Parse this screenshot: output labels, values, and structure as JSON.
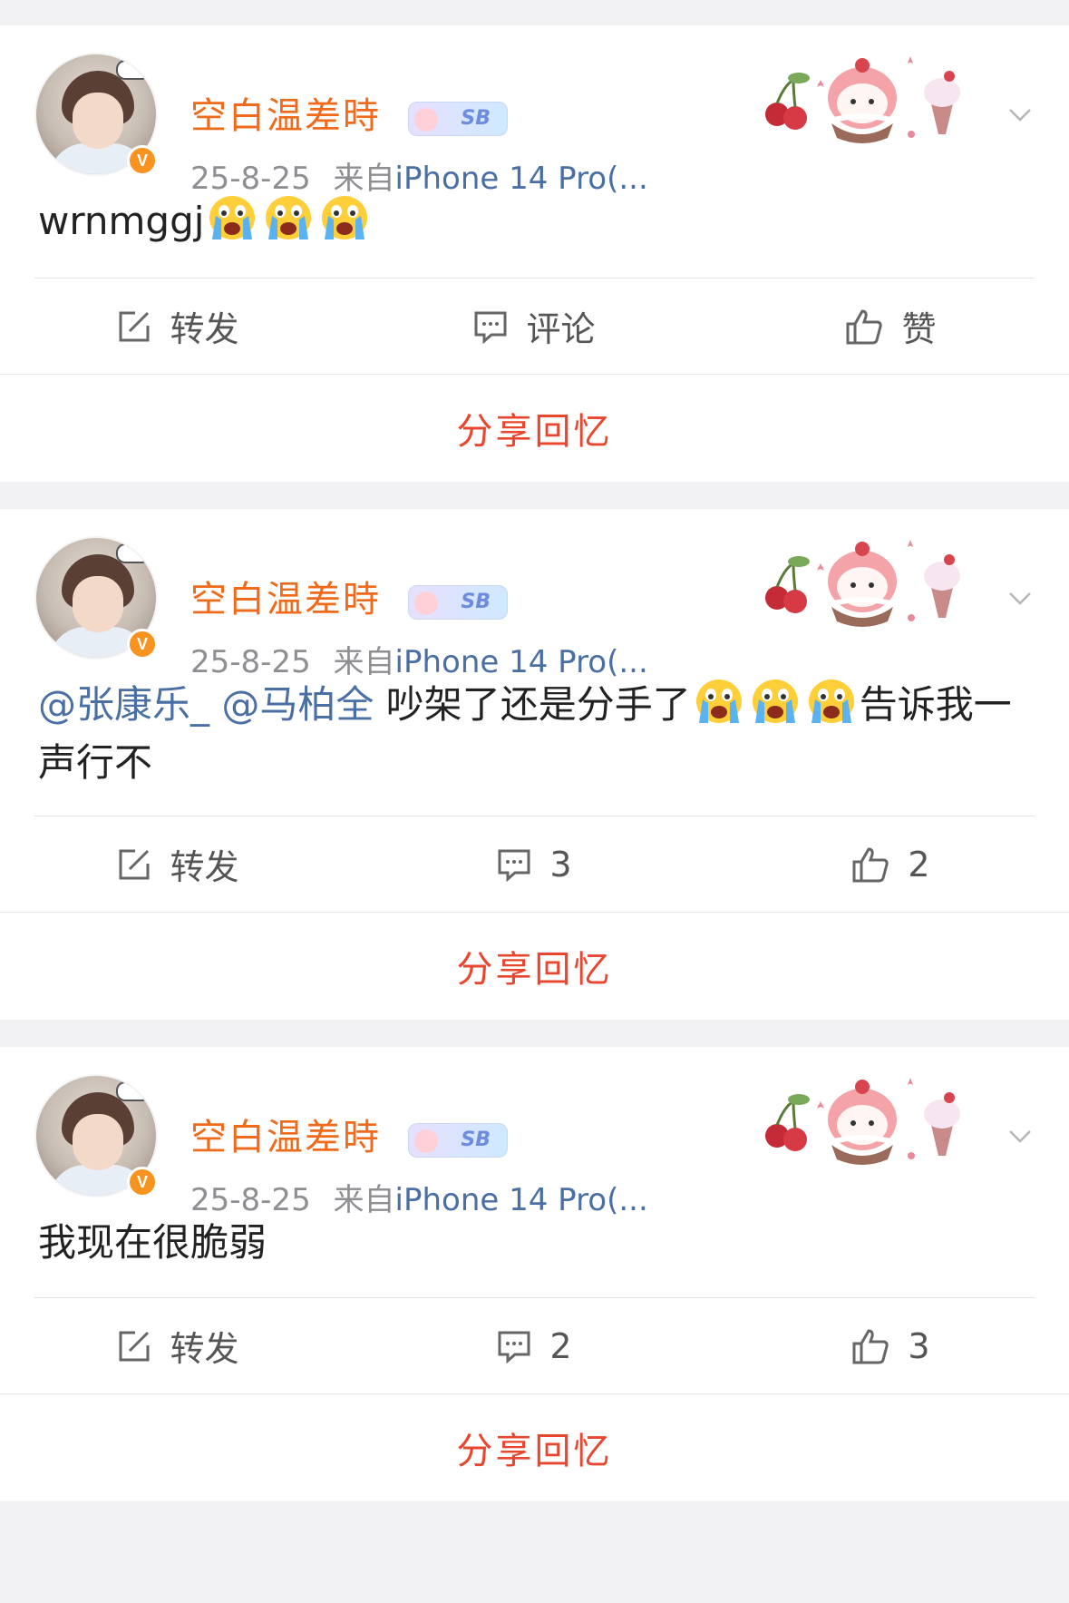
{
  "colors": {
    "username": "#f06a1b",
    "source": "#4a6fa5",
    "mention": "#4a6fa5",
    "share": "#e8462e",
    "verify": "#f7931e"
  },
  "posts": [
    {
      "username": "空白温差時",
      "badge": "SB",
      "date": "25-8-25",
      "from_label": "来自",
      "source": "iPhone 14 Pro(...",
      "text": "wrnmggj",
      "emoji_count": 3,
      "actions": {
        "repost": "转发",
        "comment": "评论",
        "like": "赞"
      },
      "share": "分享回忆"
    },
    {
      "username": "空白温差時",
      "badge": "SB",
      "date": "25-8-25",
      "from_label": "来自",
      "source": "iPhone 14 Pro(...",
      "mention1": "@张康乐_",
      "mention2": "@马柏全",
      "text_a": "吵架了还是分手了",
      "text_b": "告诉我一声行不",
      "emoji_count": 3,
      "actions": {
        "repost": "转发",
        "comment": "3",
        "like": "2"
      },
      "share": "分享回忆"
    },
    {
      "username": "空白温差時",
      "badge": "SB",
      "date": "25-8-25",
      "from_label": "来自",
      "source": "iPhone 14 Pro(...",
      "text": "我现在很脆弱",
      "actions": {
        "repost": "转发",
        "comment": "2",
        "like": "3"
      },
      "share": "分享回忆"
    }
  ]
}
